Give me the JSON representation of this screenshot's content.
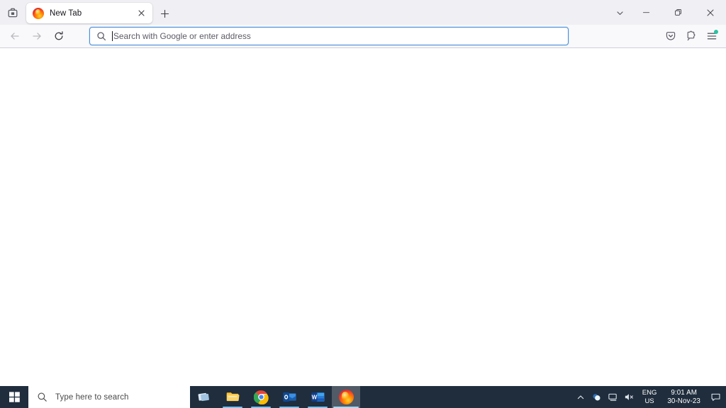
{
  "browser": {
    "name": "Mozilla Firefox",
    "firefox_view": {
      "label": "Firefox View",
      "icon": "firefox-view-icon"
    },
    "tabs": [
      {
        "title": "New Tab",
        "favicon": "firefox-favicon",
        "active": true,
        "close_label": "Close tab"
      }
    ],
    "new_tab_button": {
      "label": "Open a new tab",
      "icon": "plus-icon"
    },
    "tab_list_button": {
      "label": "List all tabs",
      "icon": "chevron-down-icon"
    },
    "window_controls": {
      "minimize": {
        "label": "Minimize",
        "icon": "minimize-icon"
      },
      "restore": {
        "label": "Restore Down",
        "icon": "restore-icon"
      },
      "close": {
        "label": "Close",
        "icon": "close-icon"
      }
    },
    "navigation": {
      "back": {
        "label": "Go back one page",
        "icon": "arrow-left-icon",
        "enabled": false
      },
      "forward": {
        "label": "Go forward one page",
        "icon": "arrow-right-icon",
        "enabled": false
      },
      "reload": {
        "label": "Reload current page",
        "icon": "reload-icon",
        "enabled": true
      }
    },
    "address_bar": {
      "value": "",
      "placeholder": "Search with Google or enter address",
      "icon": "search-icon",
      "focused": true,
      "border_color": "#4a90d9"
    },
    "toolbar_right": [
      {
        "name": "save-to-pocket-button",
        "label": "Save to Pocket",
        "icon": "pocket-icon",
        "badge": false
      },
      {
        "name": "extensions-button",
        "label": "Extensions",
        "icon": "extensions-icon",
        "badge": false
      },
      {
        "name": "application-menu-button",
        "label": "Open application menu",
        "icon": "hamburger-menu-icon",
        "badge": true,
        "badge_color": "#2ac3a2"
      }
    ],
    "content": {
      "page": "New Tab",
      "body_text": ""
    }
  },
  "taskbar": {
    "start": {
      "label": "Start",
      "icon": "windows-logo-icon"
    },
    "search": {
      "placeholder": "Type here to search",
      "value": "",
      "icon": "search-icon"
    },
    "items": [
      {
        "name": "task-view-button",
        "label": "Task View",
        "icon": "task-view-icon",
        "running": false,
        "active": false
      },
      {
        "name": "file-explorer-button",
        "label": "File Explorer",
        "icon": "file-explorer-icon",
        "running": true,
        "active": false
      },
      {
        "name": "google-chrome-button",
        "label": "Google Chrome",
        "icon": "chrome-icon",
        "running": true,
        "active": false
      },
      {
        "name": "outlook-button",
        "label": "Microsoft Outlook",
        "icon": "outlook-icon",
        "running": true,
        "active": false
      },
      {
        "name": "word-button",
        "label": "Microsoft Word",
        "icon": "word-icon",
        "running": true,
        "active": false
      },
      {
        "name": "firefox-button",
        "label": "Mozilla Firefox",
        "icon": "firefox-icon",
        "running": true,
        "active": true
      }
    ],
    "tray": {
      "show_hidden": {
        "label": "Show hidden icons",
        "icon": "chevron-up-icon"
      },
      "icons": [
        {
          "name": "onedrive-tray-icon",
          "label": "OneDrive",
          "icon": "cloud-icon"
        },
        {
          "name": "network-tray-icon",
          "label": "Network",
          "icon": "monitor-icon"
        },
        {
          "name": "volume-tray-icon",
          "label": "Volume muted",
          "icon": "speaker-muted-icon"
        }
      ],
      "language": {
        "line1": "ENG",
        "line2": "US",
        "label": "Input language"
      },
      "clock": {
        "time": "9:01 AM",
        "date": "30-Nov-23",
        "label": "Date and time"
      },
      "action_center": {
        "label": "Notifications",
        "icon": "notification-icon"
      }
    }
  }
}
